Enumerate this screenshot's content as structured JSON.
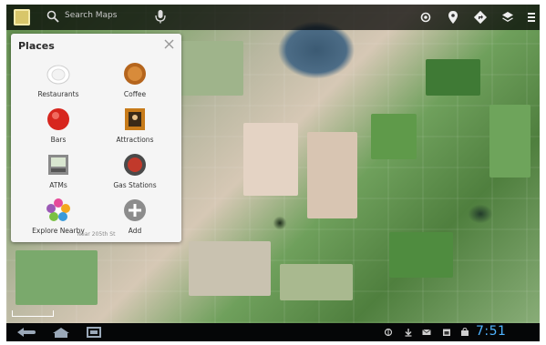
{
  "app": {
    "search_placeholder": "Search Maps"
  },
  "places_panel": {
    "title": "Places",
    "items": [
      {
        "label": "Restaurants",
        "icon": "plate-icon"
      },
      {
        "label": "Coffee",
        "icon": "coffee-icon"
      },
      {
        "label": "Bars",
        "icon": "bar-icon"
      },
      {
        "label": "Attractions",
        "icon": "attraction-icon"
      },
      {
        "label": "ATMs",
        "icon": "atm-icon"
      },
      {
        "label": "Gas Stations",
        "icon": "gas-station-icon"
      },
      {
        "label": "Explore Nearby",
        "icon": "explore-icon"
      },
      {
        "label": "Add",
        "icon": "add-icon"
      }
    ],
    "near_text": "Near 205th St"
  },
  "system_bar": {
    "clock": "7:51"
  },
  "colors": {
    "clock": "#4fb3ff",
    "action_bar": "#000000",
    "panel_bg": "#f5f5f5"
  }
}
